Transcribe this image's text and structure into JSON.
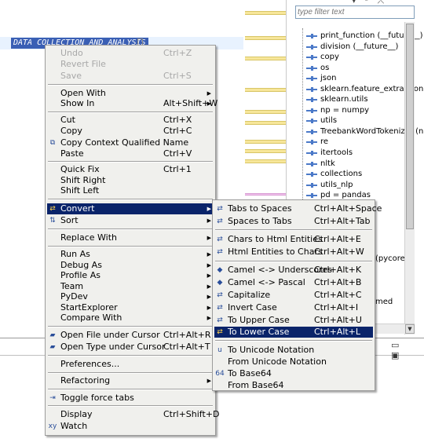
{
  "editor": {
    "selected_text": "DATA COLLECTION AND ANALYSIS"
  },
  "outline": {
    "filter_placeholder": "type filter text",
    "items": [
      "print_function (__future__)",
      "division (__future__)",
      "copy",
      "os",
      "json",
      "sklearn.feature_extraction",
      "sklearn.utils",
      "np = numpy",
      "utils",
      "TreebankWordTokenizer (nlt",
      "re",
      "itertools",
      "nltk",
      "collections",
      "utils_nlp",
      "pd = pandas"
    ],
    "partial_1": "(pycorenl",
    "partial_2": "med"
  },
  "context_menu": {
    "undo": {
      "label": "Undo",
      "shortcut": "Ctrl+Z"
    },
    "revert_file": {
      "label": "Revert File"
    },
    "save": {
      "label": "Save",
      "shortcut": "Ctrl+S"
    },
    "open_with": {
      "label": "Open With"
    },
    "show_in": {
      "label": "Show In",
      "shortcut": "Alt+Shift+W"
    },
    "cut": {
      "label": "Cut",
      "shortcut": "Ctrl+X"
    },
    "copy": {
      "label": "Copy",
      "shortcut": "Ctrl+C"
    },
    "copy_qualified": {
      "label": "Copy Context Qualified Name"
    },
    "paste": {
      "label": "Paste",
      "shortcut": "Ctrl+V"
    },
    "quick_fix": {
      "label": "Quick Fix",
      "shortcut": "Ctrl+1"
    },
    "shift_right": {
      "label": "Shift Right"
    },
    "shift_left": {
      "label": "Shift Left"
    },
    "convert": {
      "label": "Convert"
    },
    "sort": {
      "label": "Sort"
    },
    "replace_with": {
      "label": "Replace With"
    },
    "run_as": {
      "label": "Run As"
    },
    "debug_as": {
      "label": "Debug As"
    },
    "profile_as": {
      "label": "Profile As"
    },
    "team": {
      "label": "Team"
    },
    "pydev": {
      "label": "PyDev"
    },
    "start_explorer": {
      "label": "StartExplorer"
    },
    "compare_with": {
      "label": "Compare With"
    },
    "open_file_under_cursor": {
      "label": "Open File under Cursor",
      "shortcut": "Ctrl+Alt+R"
    },
    "open_type_under_cursor": {
      "label": "Open Type under Cursor",
      "shortcut": "Ctrl+Alt+T"
    },
    "preferences": {
      "label": "Preferences..."
    },
    "refactoring": {
      "label": "Refactoring"
    },
    "toggle_force_tabs": {
      "label": "Toggle force tabs"
    },
    "display": {
      "label": "Display",
      "shortcut": "Ctrl+Shift+D"
    },
    "watch": {
      "label": "Watch"
    }
  },
  "convert_submenu": {
    "tabs_to_spaces": {
      "label": "Tabs to Spaces",
      "shortcut": "Ctrl+Alt+Space"
    },
    "spaces_to_tabs": {
      "label": "Spaces to Tabs",
      "shortcut": "Ctrl+Alt+Tab"
    },
    "chars_to_html": {
      "label": "Chars to Html Entities",
      "shortcut": "Ctrl+Alt+E"
    },
    "html_to_chars": {
      "label": "Html Entities to Chars",
      "shortcut": "Ctrl+Alt+W"
    },
    "camel_to_underscores": {
      "label": "Camel <-> Underscores",
      "shortcut": "Ctrl+Alt+K"
    },
    "camel_to_pascal": {
      "label": "Camel <-> Pascal",
      "shortcut": "Ctrl+Alt+B"
    },
    "capitalize": {
      "label": "Capitalize",
      "shortcut": "Ctrl+Alt+C"
    },
    "invert_case": {
      "label": "Invert Case",
      "shortcut": "Ctrl+Alt+I"
    },
    "to_upper_case": {
      "label": "To Upper Case",
      "shortcut": "Ctrl+Alt+U"
    },
    "to_lower_case": {
      "label": "To Lower Case",
      "shortcut": "Ctrl+Alt+L"
    },
    "to_unicode": {
      "label": "To Unicode Notation"
    },
    "from_unicode": {
      "label": "From Unicode Notation"
    },
    "to_base64": {
      "label": "To Base64"
    },
    "from_base64": {
      "label": "From Base64"
    }
  },
  "colors": {
    "menu_bg": "#f0f0ed",
    "highlight": "#0a246a",
    "selection": "#3a5fb4"
  }
}
